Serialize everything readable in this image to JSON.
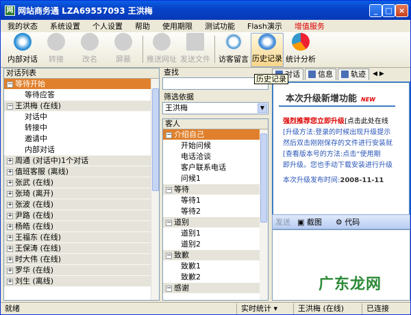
{
  "window": {
    "title": "网站商务通   LZA69557093 王洪梅",
    "icon": "app-icon"
  },
  "title_buttons": [
    "_",
    "□",
    "×"
  ],
  "menu": [
    "我的状态",
    "系统设置",
    "个人设置",
    "帮助",
    "使用期限",
    "测试功能",
    "Flash演示",
    "增值服务"
  ],
  "toolbar": [
    {
      "label": "内部对话",
      "state": "enabled"
    },
    {
      "label": "转接",
      "state": "disabled"
    },
    {
      "label": "改名",
      "state": "disabled"
    },
    {
      "label": "屏蔽",
      "state": "disabled"
    },
    {
      "label": "推送网址",
      "state": "disabled"
    },
    {
      "label": "发送文件",
      "state": "disabled"
    },
    {
      "label": "访客留言",
      "state": "enabled"
    },
    {
      "label": "历史记录",
      "state": "active"
    },
    {
      "label": "统计分析",
      "state": "enabled"
    }
  ],
  "tooltip": "历史记录",
  "dialog_list": {
    "header": "对话列表",
    "rows": [
      {
        "text": "等待开始",
        "kind": "group",
        "open": true,
        "selected": true
      },
      {
        "text": "等待应答",
        "kind": "child"
      },
      {
        "text": "王洪梅 (在线)",
        "kind": "group",
        "open": true
      },
      {
        "text": "对话中",
        "kind": "child"
      },
      {
        "text": "转接中",
        "kind": "child"
      },
      {
        "text": "邀请中",
        "kind": "child"
      },
      {
        "text": "内部对话",
        "kind": "child"
      },
      {
        "text": "周通 (对话中)1个对话",
        "kind": "group",
        "open": false
      },
      {
        "text": "值班客服 (离线)",
        "kind": "group",
        "open": false
      },
      {
        "text": "张武 (在线)",
        "kind": "group",
        "open": false
      },
      {
        "text": "张琦 (离开)",
        "kind": "group",
        "open": false
      },
      {
        "text": "张波 (在线)",
        "kind": "group",
        "open": false
      },
      {
        "text": "尹路 (在线)",
        "kind": "group",
        "open": false
      },
      {
        "text": "杨皓 (在线)",
        "kind": "group",
        "open": false
      },
      {
        "text": "王福东 (在线)",
        "kind": "group",
        "open": false
      },
      {
        "text": "王保涛 (在线)",
        "kind": "group",
        "open": false
      },
      {
        "text": "时大伟 (在线)",
        "kind": "group",
        "open": false
      },
      {
        "text": "罗华 (在线)",
        "kind": "group",
        "open": false
      },
      {
        "text": "刘生 (离线)",
        "kind": "group",
        "open": false
      }
    ]
  },
  "search": {
    "label": "查找",
    "value": ""
  },
  "filter": {
    "label": "筛选依据",
    "value": "王洪梅"
  },
  "guest": {
    "header": "客人",
    "rows": [
      {
        "text": "介绍自己",
        "kind": "group",
        "selected": true
      },
      {
        "text": "开始问候",
        "kind": "child"
      },
      {
        "text": "电话洽谈",
        "kind": "child"
      },
      {
        "text": "客户联系电话",
        "kind": "child"
      },
      {
        "text": "问候1",
        "kind": "child"
      },
      {
        "text": "等待",
        "kind": "group"
      },
      {
        "text": "等待1",
        "kind": "child"
      },
      {
        "text": "等待2",
        "kind": "child"
      },
      {
        "text": "道别",
        "kind": "group"
      },
      {
        "text": "道别1",
        "kind": "child"
      },
      {
        "text": "道别2",
        "kind": "child"
      },
      {
        "text": "致歉",
        "kind": "group"
      },
      {
        "text": "致歉1",
        "kind": "child"
      },
      {
        "text": "致歉2",
        "kind": "child"
      },
      {
        "text": "感谢",
        "kind": "group"
      }
    ]
  },
  "right_tabs": [
    "对话",
    "信息",
    "轨迹"
  ],
  "info": {
    "title": "本次升级新增功能",
    "badge": "NEW",
    "line1_red": "强烈推荐您立即升级",
    "line1_rest": "[点击此处在线",
    "line2": "[升级方法:登录的时候出现升级提示",
    "line3": "然后双击刚刚保存的文件进行安装就",
    "line4": "[查看版本号的方法:点击“使用期",
    "line5": "即升级。您也手动下载安装进行升级",
    "line6_label": "本次升级发布时间:",
    "line6_date": "2008-11-11"
  },
  "input_bar": {
    "send": "发送",
    "screenshot": "截图",
    "code": "代码"
  },
  "watermark": "广东龙网",
  "status": {
    "left": "就绪",
    "stat": "实时统计",
    "user": "王洪梅 (在线)",
    "conn": "已连接"
  }
}
